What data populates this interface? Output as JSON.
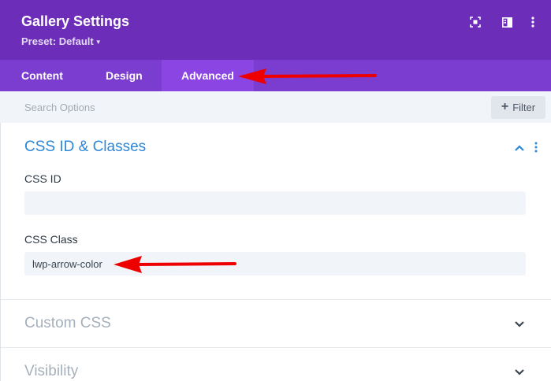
{
  "header": {
    "title": "Gallery Settings",
    "preset_label": "Preset: Default",
    "icons": [
      "expand-icon",
      "split-view-icon",
      "more-vertical-icon"
    ]
  },
  "tabs": [
    {
      "label": "Content",
      "active": false
    },
    {
      "label": "Design",
      "active": false
    },
    {
      "label": "Advanced",
      "active": true
    }
  ],
  "search": {
    "placeholder": "Search Options",
    "value": "",
    "filter_label": "Filter"
  },
  "sections": [
    {
      "title": "CSS ID & Classes",
      "expanded": true,
      "fields": [
        {
          "label": "CSS ID",
          "value": ""
        },
        {
          "label": "CSS Class",
          "value": "lwp-arrow-color"
        }
      ]
    },
    {
      "title": "Custom CSS",
      "expanded": false
    },
    {
      "title": "Visibility",
      "expanded": false
    }
  ],
  "colors": {
    "header_bg": "#6c2eb9",
    "tabs_bg": "#7b3cd0",
    "tab_active_bg": "#8b45e3",
    "accent": "#2b87da",
    "annotation_arrow": "#ee0000"
  }
}
